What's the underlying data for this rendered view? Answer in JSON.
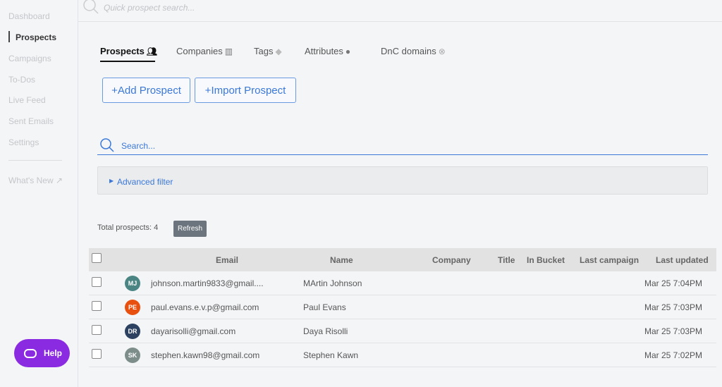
{
  "sidebar": {
    "items": [
      "Dashboard",
      "Prospects",
      "Campaigns",
      "To-Dos",
      "Live Feed",
      "Sent Emails",
      "Settings"
    ],
    "whats_new": "What's New"
  },
  "topbar": {
    "placeholder": "Quick prospect search..."
  },
  "tabs": [
    "Prospects",
    "Companies",
    "Tags",
    "Attributes",
    "DnC domains"
  ],
  "buttons": {
    "add": "Add Prospect",
    "import": "Import Prospect",
    "refresh": "Refresh",
    "help": "Help"
  },
  "search": {
    "placeholder": "Search..."
  },
  "filter": {
    "label": "Advanced filter"
  },
  "total": "Total prospects: 4",
  "table": {
    "headers": [
      "Email",
      "Name",
      "Company",
      "Title",
      "In Bucket",
      "Last campaign",
      "Last updated"
    ],
    "rows": [
      {
        "initials": "MJ",
        "color": "#4a8584",
        "email": "johnson.martin9833@gmail....",
        "name": "MArtin Johnson",
        "updated": "Mar 25 7:04PM"
      },
      {
        "initials": "PE",
        "color": "#e8500f",
        "email": "paul.evans.e.v.p@gmail.com",
        "name": "Paul Evans",
        "updated": "Mar 25 7:03PM"
      },
      {
        "initials": "DR",
        "color": "#2d4261",
        "email": "dayarisolli@gmail.com",
        "name": "Daya Risolli",
        "updated": "Mar 25 7:03PM"
      },
      {
        "initials": "SK",
        "color": "#7d8d8a",
        "email": "stephen.kawn98@gmail.com",
        "name": "Stephen Kawn",
        "updated": "Mar 25 7:02PM"
      }
    ]
  }
}
